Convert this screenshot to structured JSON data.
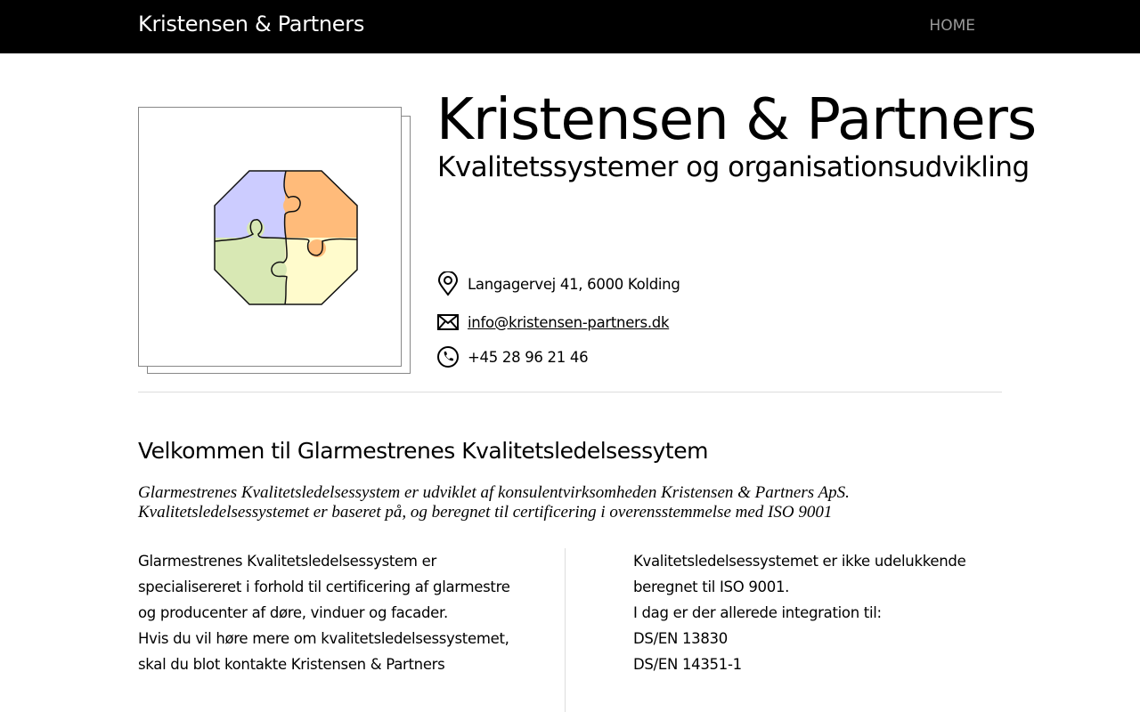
{
  "nav": {
    "brand": "Kristensen & Partners",
    "home": "HOME"
  },
  "header": {
    "title": "Kristensen & Partners",
    "subtitle": "Kvalitetssystemer og organisationsudvikling"
  },
  "contact": {
    "address": "Langagervej 41, 6000 Kolding",
    "email": "info@kristensen-partners.dk",
    "phone": "+45 28 96 21 46"
  },
  "welcome": {
    "heading": "Velkommen til Glarmestrenes Kvalitetsledelsessytem",
    "intro": [
      "Glarmestrenes Kvalitetsledelsessystem er udviklet af konsulentvirksomheden Kristensen & Partners ApS.",
      "Kvalitetsledelsessystemet er baseret på, og beregnet til certificering i overensstemmelse med ISO 9001"
    ]
  },
  "left_col": [
    "Glarmestrenes Kvalitetsledelsessystem er",
    "specialisereret i forhold til certificering af glarmestre",
    "og producenter af døre, vinduer og facader.",
    "Hvis du vil høre mere om kvalitetsledelsessystemet,",
    "skal du blot kontakte Kristensen & Partners"
  ],
  "right_col": [
    "Kvalitetsledelsessystemet er ikke udelukkende",
    "beregnet til ISO 9001.",
    "I dag er der allerede integration til:",
    "DS/EN 13830",
    "DS/EN 14351-1"
  ],
  "colors": {
    "purple": "#ccccff",
    "orange": "#ffbb7a",
    "green": "#d8e8b4",
    "yellow": "#fffbcc"
  }
}
